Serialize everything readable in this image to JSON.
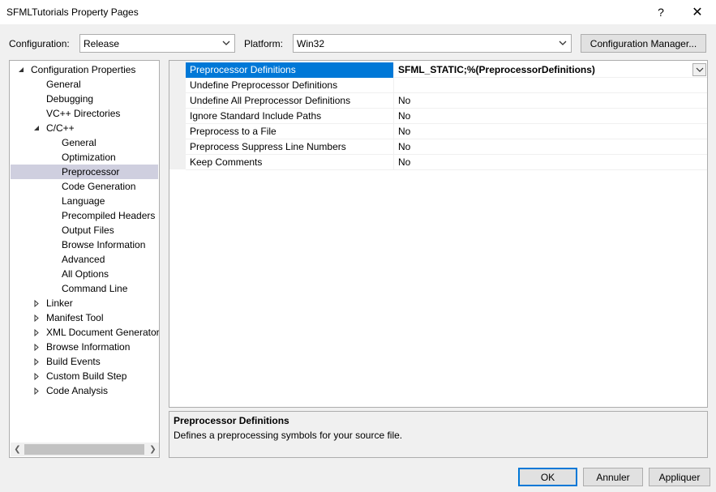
{
  "window": {
    "title": "SFMLTutorials Property Pages",
    "help_label": "?",
    "close_label": "✕"
  },
  "toolbar": {
    "configuration_label": "Configuration:",
    "configuration_value": "Release",
    "platform_label": "Platform:",
    "platform_value": "Win32",
    "config_manager_label": "Configuration Manager..."
  },
  "tree": {
    "items": [
      {
        "label": "Configuration Properties",
        "level": 0,
        "expander": "expanded"
      },
      {
        "label": "General",
        "level": 1,
        "expander": "none"
      },
      {
        "label": "Debugging",
        "level": 1,
        "expander": "none"
      },
      {
        "label": "VC++ Directories",
        "level": 1,
        "expander": "none"
      },
      {
        "label": "C/C++",
        "level": 1,
        "expander": "expanded"
      },
      {
        "label": "General",
        "level": 2,
        "expander": "none"
      },
      {
        "label": "Optimization",
        "level": 2,
        "expander": "none"
      },
      {
        "label": "Preprocessor",
        "level": 2,
        "expander": "none",
        "selected": true
      },
      {
        "label": "Code Generation",
        "level": 2,
        "expander": "none"
      },
      {
        "label": "Language",
        "level": 2,
        "expander": "none"
      },
      {
        "label": "Precompiled Headers",
        "level": 2,
        "expander": "none"
      },
      {
        "label": "Output Files",
        "level": 2,
        "expander": "none"
      },
      {
        "label": "Browse Information",
        "level": 2,
        "expander": "none"
      },
      {
        "label": "Advanced",
        "level": 2,
        "expander": "none"
      },
      {
        "label": "All Options",
        "level": 2,
        "expander": "none"
      },
      {
        "label": "Command Line",
        "level": 2,
        "expander": "none"
      },
      {
        "label": "Linker",
        "level": 1,
        "expander": "collapsed"
      },
      {
        "label": "Manifest Tool",
        "level": 1,
        "expander": "collapsed"
      },
      {
        "label": "XML Document Generator",
        "level": 1,
        "expander": "collapsed"
      },
      {
        "label": "Browse Information",
        "level": 1,
        "expander": "collapsed"
      },
      {
        "label": "Build Events",
        "level": 1,
        "expander": "collapsed"
      },
      {
        "label": "Custom Build Step",
        "level": 1,
        "expander": "collapsed"
      },
      {
        "label": "Code Analysis",
        "level": 1,
        "expander": "collapsed"
      }
    ]
  },
  "grid": {
    "rows": [
      {
        "name": "Preprocessor Definitions",
        "value": "SFML_STATIC;%(PreprocessorDefinitions)",
        "selected": true
      },
      {
        "name": "Undefine Preprocessor Definitions",
        "value": ""
      },
      {
        "name": "Undefine All Preprocessor Definitions",
        "value": "No"
      },
      {
        "name": "Ignore Standard Include Paths",
        "value": "No"
      },
      {
        "name": "Preprocess to a File",
        "value": "No"
      },
      {
        "name": "Preprocess Suppress Line Numbers",
        "value": "No"
      },
      {
        "name": "Keep Comments",
        "value": "No"
      }
    ]
  },
  "description": {
    "title": "Preprocessor Definitions",
    "text": "Defines a preprocessing symbols for your source file."
  },
  "footer": {
    "ok_label": "OK",
    "cancel_label": "Annuler",
    "apply_label": "Appliquer"
  },
  "colors": {
    "accent": "#0078d7",
    "tree_selection": "#cfcfdf",
    "panel_bg": "#f0f0f0"
  },
  "icons": {
    "expanded": "triangle-down-right-icon",
    "collapsed": "triangle-right-icon",
    "dropdown": "chevron-down-icon"
  }
}
